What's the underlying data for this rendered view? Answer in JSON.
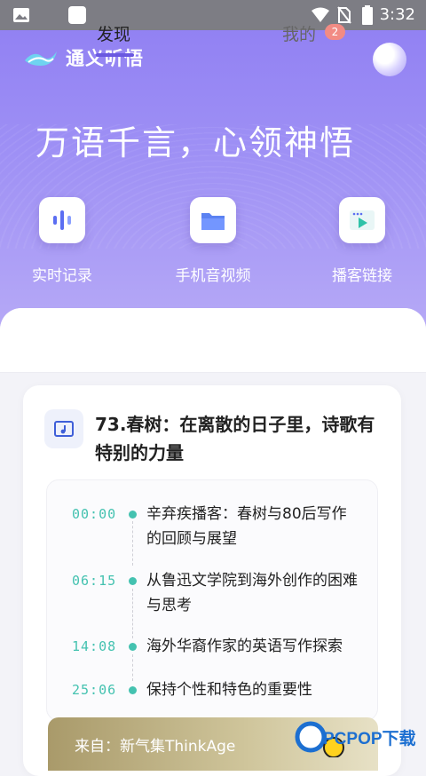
{
  "status_bar": {
    "time": "3:32",
    "left_icons": [
      "image-icon",
      "square-icon"
    ],
    "right_icons": [
      "wifi-icon",
      "no-sim-icon",
      "battery-icon"
    ]
  },
  "app": {
    "name": "通义听悟",
    "slogan": "万语千言，心领神悟"
  },
  "features": [
    {
      "label": "实时记录",
      "icon": "audio-wave-icon"
    },
    {
      "label": "手机音视频",
      "icon": "folder-icon"
    },
    {
      "label": "播客链接",
      "icon": "play-icon"
    }
  ],
  "tabs": [
    {
      "label": "发现",
      "active": true
    },
    {
      "label": "我的",
      "badge": "2"
    }
  ],
  "episode": {
    "title": "73.春树：在离散的日子里，诗歌有特别的力量",
    "chapters": [
      {
        "time": "00:00",
        "text": "辛弃疾播客：春树与80后写作的回顾与展望"
      },
      {
        "time": "06:15",
        "text": "从鲁迅文学院到海外创作的困难与思考"
      },
      {
        "time": "14:08",
        "text": "海外华裔作家的英语写作探索"
      },
      {
        "time": "25:06",
        "text": "保持个性和特色的重要性"
      }
    ],
    "source": "来自：新气集ThinkAge"
  },
  "watermark": {
    "text": "PCPOP下载"
  },
  "colors": {
    "accent": "#6a58e0",
    "teal": "#44c2b0",
    "badge": "#f28b84"
  }
}
